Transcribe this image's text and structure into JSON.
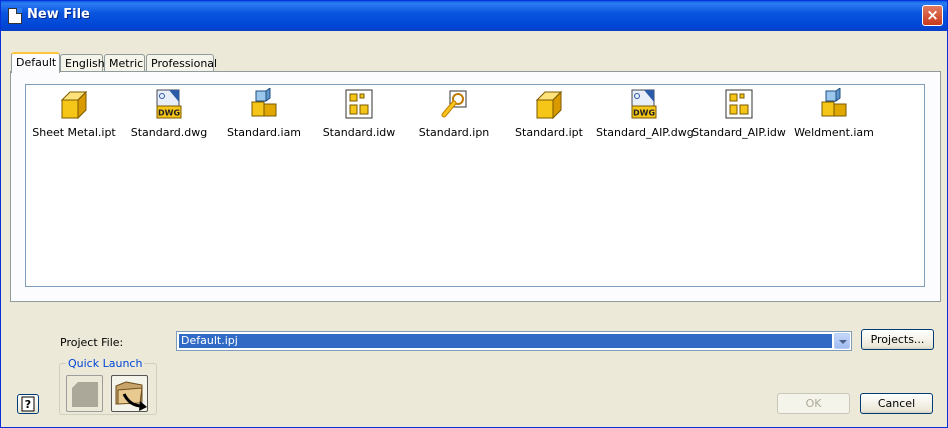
{
  "window": {
    "title": "New File",
    "close_label": "×"
  },
  "tabs": [
    {
      "label": "Default",
      "active": true
    },
    {
      "label": "English",
      "active": false
    },
    {
      "label": "Metric",
      "active": false
    },
    {
      "label": "Professional",
      "active": false
    }
  ],
  "files": [
    {
      "name": "Sheet Metal.ipt",
      "icon": "part-icon"
    },
    {
      "name": "Standard.dwg",
      "icon": "dwg-icon"
    },
    {
      "name": "Standard.iam",
      "icon": "assembly-icon"
    },
    {
      "name": "Standard.idw",
      "icon": "drawing-icon"
    },
    {
      "name": "Standard.ipn",
      "icon": "presentation-icon"
    },
    {
      "name": "Standard.ipt",
      "icon": "part-icon"
    },
    {
      "name": "Standard_AIP.dwg",
      "icon": "dwg-icon"
    },
    {
      "name": "Standard_AIP.idw",
      "icon": "drawing-icon"
    },
    {
      "name": "Weldment.iam",
      "icon": "assembly-icon"
    }
  ],
  "project": {
    "label": "Project File:",
    "value": "Default.ipj",
    "projects_button": "Projects..."
  },
  "quick_launch": {
    "label": "Quick Launch"
  },
  "buttons": {
    "ok": "OK",
    "cancel": "Cancel",
    "help_glyph": "?"
  },
  "colors": {
    "title_bar": "#0a55e0",
    "selection": "#316ac5",
    "face": "#ece9d8",
    "part_yellow": "#f5c518"
  }
}
